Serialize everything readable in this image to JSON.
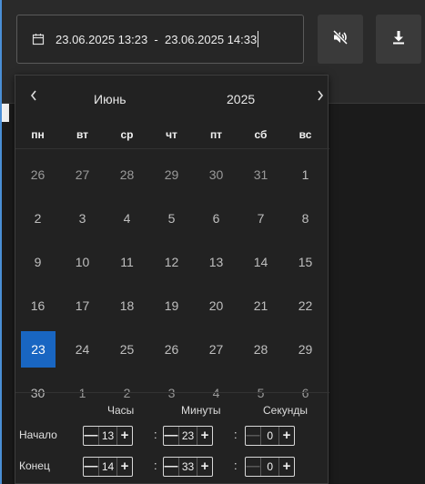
{
  "range": {
    "text": "23.06.2025 13:23  -  23.06.2025 14:33"
  },
  "toolbar": {
    "mute_icon": "speaker-muted-icon",
    "download_icon": "download-icon"
  },
  "calendar": {
    "month": "Июнь",
    "year": "2025",
    "prev_icon": "chevron-left-icon",
    "next_icon": "chevron-right-icon",
    "weekdays": [
      "пн",
      "вт",
      "ср",
      "чт",
      "пт",
      "сб",
      "вс"
    ],
    "weeks": [
      [
        "26",
        "27",
        "28",
        "29",
        "30",
        "31",
        "1"
      ],
      [
        "2",
        "3",
        "4",
        "5",
        "6",
        "7",
        "8"
      ],
      [
        "9",
        "10",
        "11",
        "12",
        "13",
        "14",
        "15"
      ],
      [
        "16",
        "17",
        "18",
        "19",
        "20",
        "21",
        "22"
      ],
      [
        "23",
        "24",
        "25",
        "26",
        "27",
        "28",
        "29"
      ],
      [
        "30",
        "1",
        "2",
        "3",
        "4",
        "5",
        "6"
      ]
    ],
    "selected_day": "23",
    "accent_color": "#1966c2"
  },
  "time": {
    "headers": {
      "hours": "Часы",
      "minutes": "Минуты",
      "seconds": "Секунды"
    },
    "start": {
      "label": "Начало",
      "hours": "13",
      "minutes": "23",
      "seconds": "0"
    },
    "end": {
      "label": "Конец",
      "hours": "14",
      "minutes": "33",
      "seconds": "0"
    },
    "separator": ":",
    "minus": "—",
    "plus": "+"
  }
}
